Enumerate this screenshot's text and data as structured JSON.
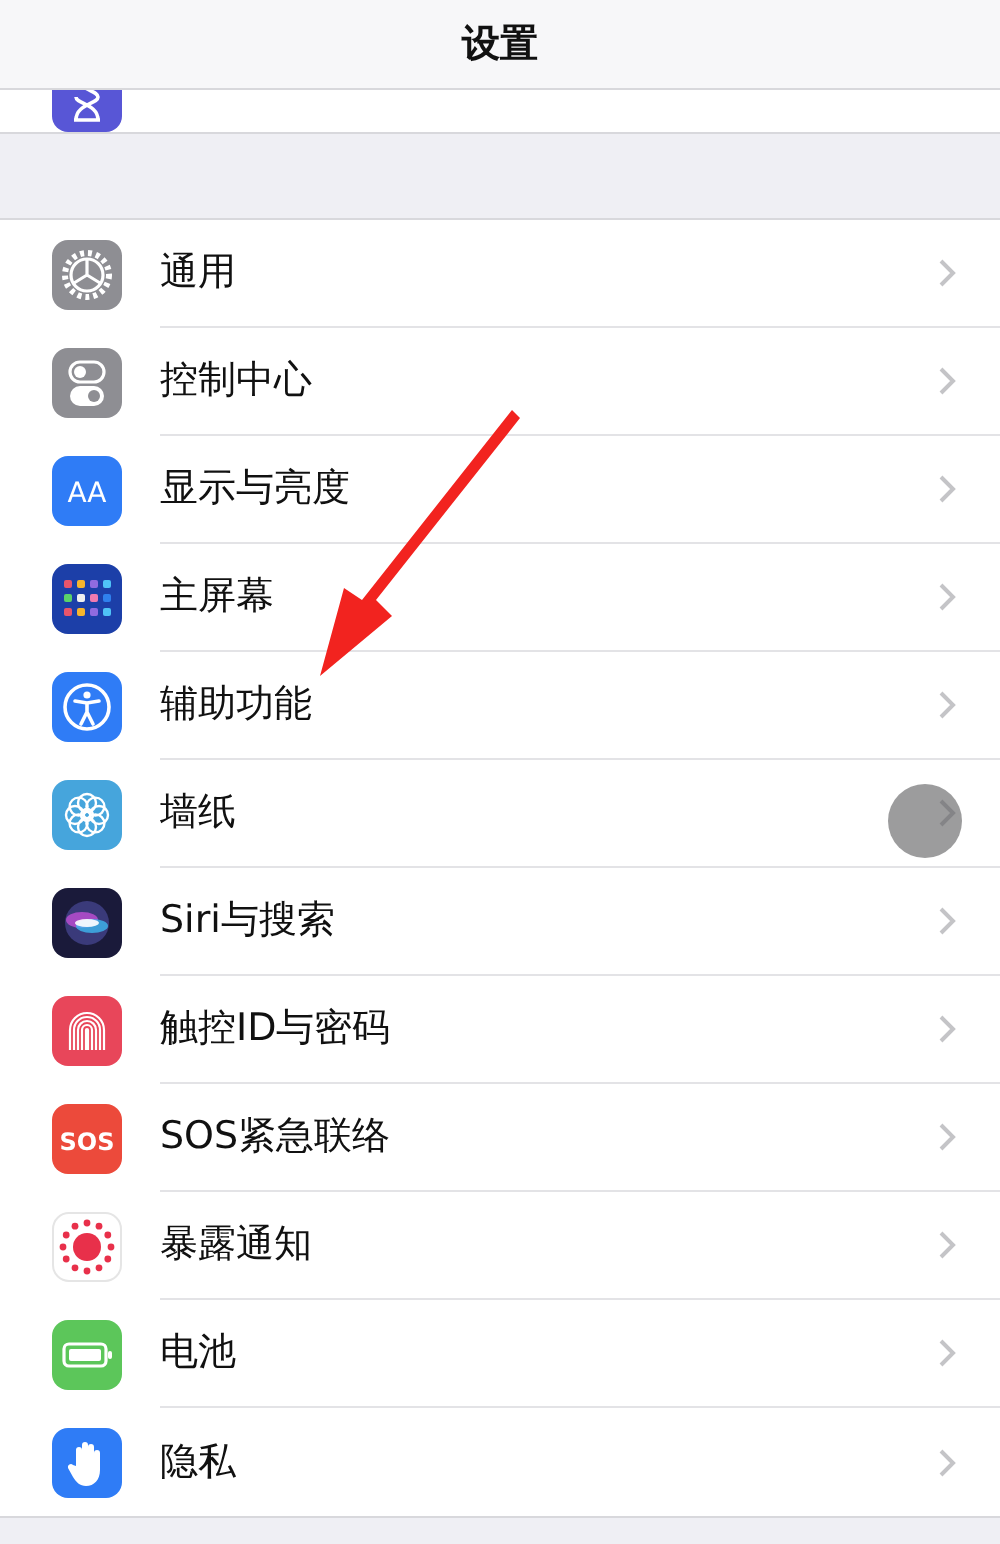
{
  "header": {
    "title": "设置"
  },
  "partial_row": {
    "kind": "hourglass"
  },
  "rows": [
    {
      "label": "通用",
      "kind": "gear"
    },
    {
      "label": "控制中心",
      "kind": "switches"
    },
    {
      "label": "显示与亮度",
      "kind": "text",
      "icon_text": "AA"
    },
    {
      "label": "主屏幕",
      "kind": "grid"
    },
    {
      "label": "辅助功能",
      "kind": "accessibility"
    },
    {
      "label": "墙纸",
      "kind": "flower"
    },
    {
      "label": "Siri与搜索",
      "kind": "siri"
    },
    {
      "label": "触控ID与密码",
      "kind": "fingerprint"
    },
    {
      "label": "SOS紧急联络",
      "kind": "text",
      "icon_text": "SOS"
    },
    {
      "label": "暴露通知",
      "kind": "exposure"
    },
    {
      "label": "电池",
      "kind": "battery"
    },
    {
      "label": "隐私",
      "kind": "hand"
    }
  ],
  "floating_button": {
    "kind": "assistive_touch"
  },
  "annotation": {
    "kind": "arrow"
  }
}
